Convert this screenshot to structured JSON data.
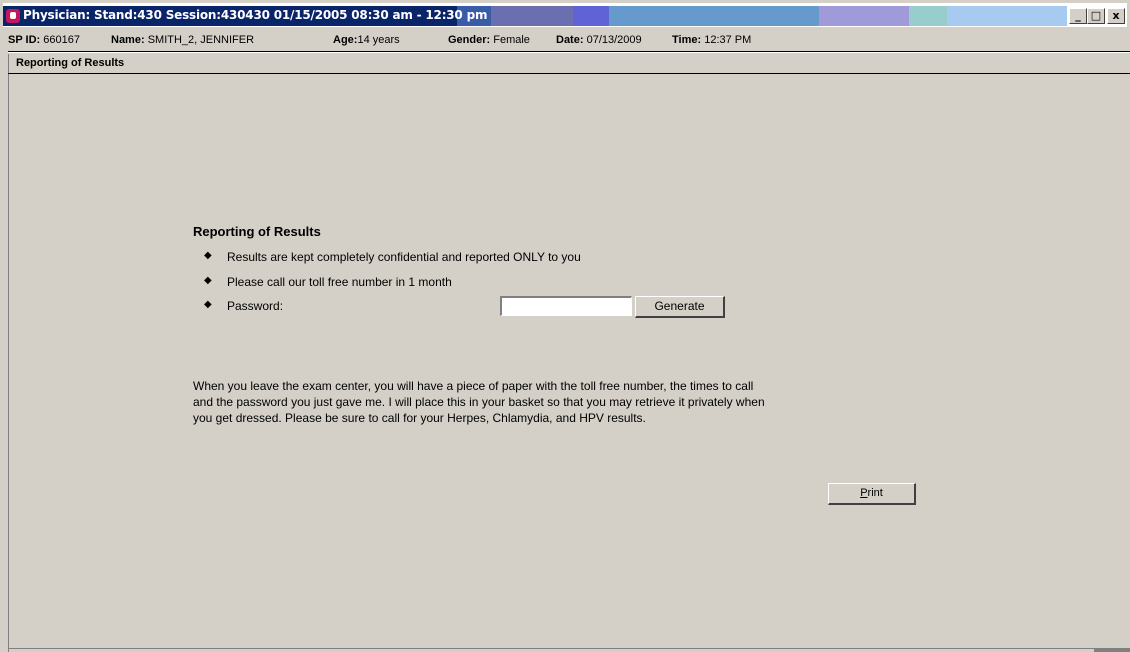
{
  "window": {
    "title": "Physician: Stand:430 Session:430430 01/15/2005 08:30 am - 12:30 pm",
    "controls": {
      "minimize": "_",
      "maximize": "□",
      "close": "x"
    },
    "title_colors": [
      "#0a246a",
      "#3a5ba8",
      "#6a6fb0",
      "#5f63d6",
      "#6699cc",
      "#a09ad8",
      "#99cccc",
      "#a6caf0"
    ]
  },
  "patient": {
    "spid_label": "SP ID:",
    "spid_value": "660167",
    "name_label": "Name:",
    "name_value": "SMITH_2, JENNIFER",
    "age_label": "Age:",
    "age_value": "14 years",
    "gender_label": "Gender:",
    "gender_value": "Female",
    "date_label": "Date:",
    "date_value": "07/13/2009",
    "time_label": "Time:",
    "time_value": "12:37 PM"
  },
  "section": {
    "header": "Reporting of Results"
  },
  "main": {
    "title": "Reporting of Results",
    "bullets": [
      "Results are kept completely confidential and reported ONLY to you",
      "Please call our toll free number in 1 month",
      "Password:"
    ],
    "bullet_glyph": "◆",
    "password_value": "",
    "generate_label": "Generate",
    "paragraph_lines": [
      "When you leave the exam center, you will have a piece of paper with the toll free number, the times to call",
      "and the password you just gave me. I will place this in your basket so that you may retrieve it privately when",
      "you get dressed. Please be sure to call for your Herpes, Chlamydia, and HPV results."
    ],
    "print_label_underlined": "P",
    "print_label_rest": "rint"
  }
}
